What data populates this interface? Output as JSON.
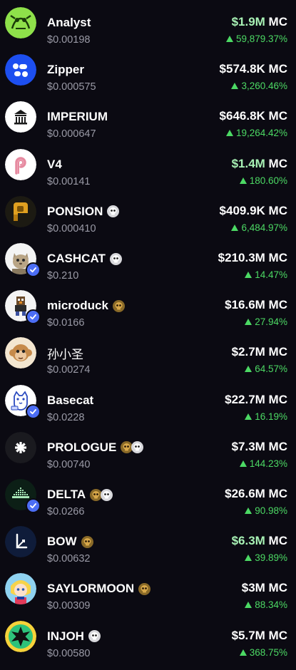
{
  "tokens": [
    {
      "name": "Analyst",
      "price": "$0.00198",
      "mc_value": "$1.9M",
      "mc_suffix": " MC",
      "change": "59,879.37%",
      "highlight": true,
      "icon": "analyst-avatar",
      "verified": false,
      "badges": []
    },
    {
      "name": "Zipper",
      "price": "$0.000575",
      "mc_value": "$574.8K",
      "mc_suffix": " MC",
      "change": "3,260.46%",
      "highlight": false,
      "icon": "zipper-avatar",
      "verified": false,
      "badges": []
    },
    {
      "name": "IMPERIUM",
      "price": "$0.000647",
      "mc_value": "$646.8K",
      "mc_suffix": " MC",
      "change": "19,264.42%",
      "highlight": false,
      "icon": "imperium-avatar",
      "verified": false,
      "badges": []
    },
    {
      "name": "V4",
      "price": "$0.00141",
      "mc_value": "$1.4M",
      "mc_suffix": " MC",
      "change": "180.60%",
      "highlight": true,
      "icon": "v4-avatar",
      "verified": false,
      "badges": []
    },
    {
      "name": "PONSION",
      "price": "$0.000410",
      "mc_value": "$409.9K",
      "mc_suffix": " MC",
      "change": "6,484.97%",
      "highlight": false,
      "icon": "ponsion-avatar",
      "verified": false,
      "badges": [
        "skull-badge"
      ]
    },
    {
      "name": "CASHCAT",
      "price": "$0.210",
      "mc_value": "$210.3M",
      "mc_suffix": " MC",
      "change": "14.47%",
      "highlight": false,
      "icon": "cashcat-avatar",
      "verified": true,
      "badges": [
        "skull-badge"
      ]
    },
    {
      "name": "microduck",
      "price": "$0.0166",
      "mc_value": "$16.6M",
      "mc_suffix": " MC",
      "change": "27.94%",
      "highlight": false,
      "icon": "microduck-avatar",
      "verified": true,
      "badges": [
        "gold-skull-badge"
      ]
    },
    {
      "name": "孙小圣",
      "price": "$0.00274",
      "mc_value": "$2.7M",
      "mc_suffix": " MC",
      "change": "64.57%",
      "highlight": false,
      "icon": "monkey-avatar",
      "verified": false,
      "badges": []
    },
    {
      "name": "Basecat",
      "price": "$0.0228",
      "mc_value": "$22.7M",
      "mc_suffix": " MC",
      "change": "16.19%",
      "highlight": false,
      "icon": "basecat-avatar",
      "verified": true,
      "badges": []
    },
    {
      "name": "PROLOGUE",
      "price": "$0.00740",
      "mc_value": "$7.3M",
      "mc_suffix": " MC",
      "change": "144.23%",
      "highlight": false,
      "icon": "prologue-avatar",
      "verified": false,
      "badges": [
        "gold-skull-badge",
        "skull-badge"
      ]
    },
    {
      "name": "DELTA",
      "price": "$0.0266",
      "mc_value": "$26.6M",
      "mc_suffix": " MC",
      "change": "90.98%",
      "highlight": false,
      "icon": "delta-avatar",
      "verified": true,
      "badges": [
        "gold-skull-badge",
        "skull-badge"
      ]
    },
    {
      "name": "BOW",
      "price": "$0.00632",
      "mc_value": "$6.3M",
      "mc_suffix": " MC",
      "change": "39.89%",
      "highlight": true,
      "icon": "bow-avatar",
      "verified": false,
      "badges": [
        "gold-skull-badge"
      ]
    },
    {
      "name": "SAYLORMOON",
      "price": "$0.00309",
      "mc_value": "$3M",
      "mc_suffix": " MC",
      "change": "88.34%",
      "highlight": false,
      "icon": "saylormoon-avatar",
      "verified": false,
      "badges": [
        "gold-skull-badge"
      ]
    },
    {
      "name": "INJOH",
      "price": "$0.00580",
      "mc_value": "$5.7M",
      "mc_suffix": " MC",
      "change": "368.75%",
      "highlight": false,
      "icon": "injoh-avatar",
      "verified": false,
      "badges": [
        "skull-badge"
      ]
    }
  ],
  "colors": {
    "background": "#0b0a12",
    "positive": "#4cd964",
    "mc_highlight": "#a8f2b5",
    "price_text": "#9a9aa6",
    "verified": "#4c6ef5"
  }
}
